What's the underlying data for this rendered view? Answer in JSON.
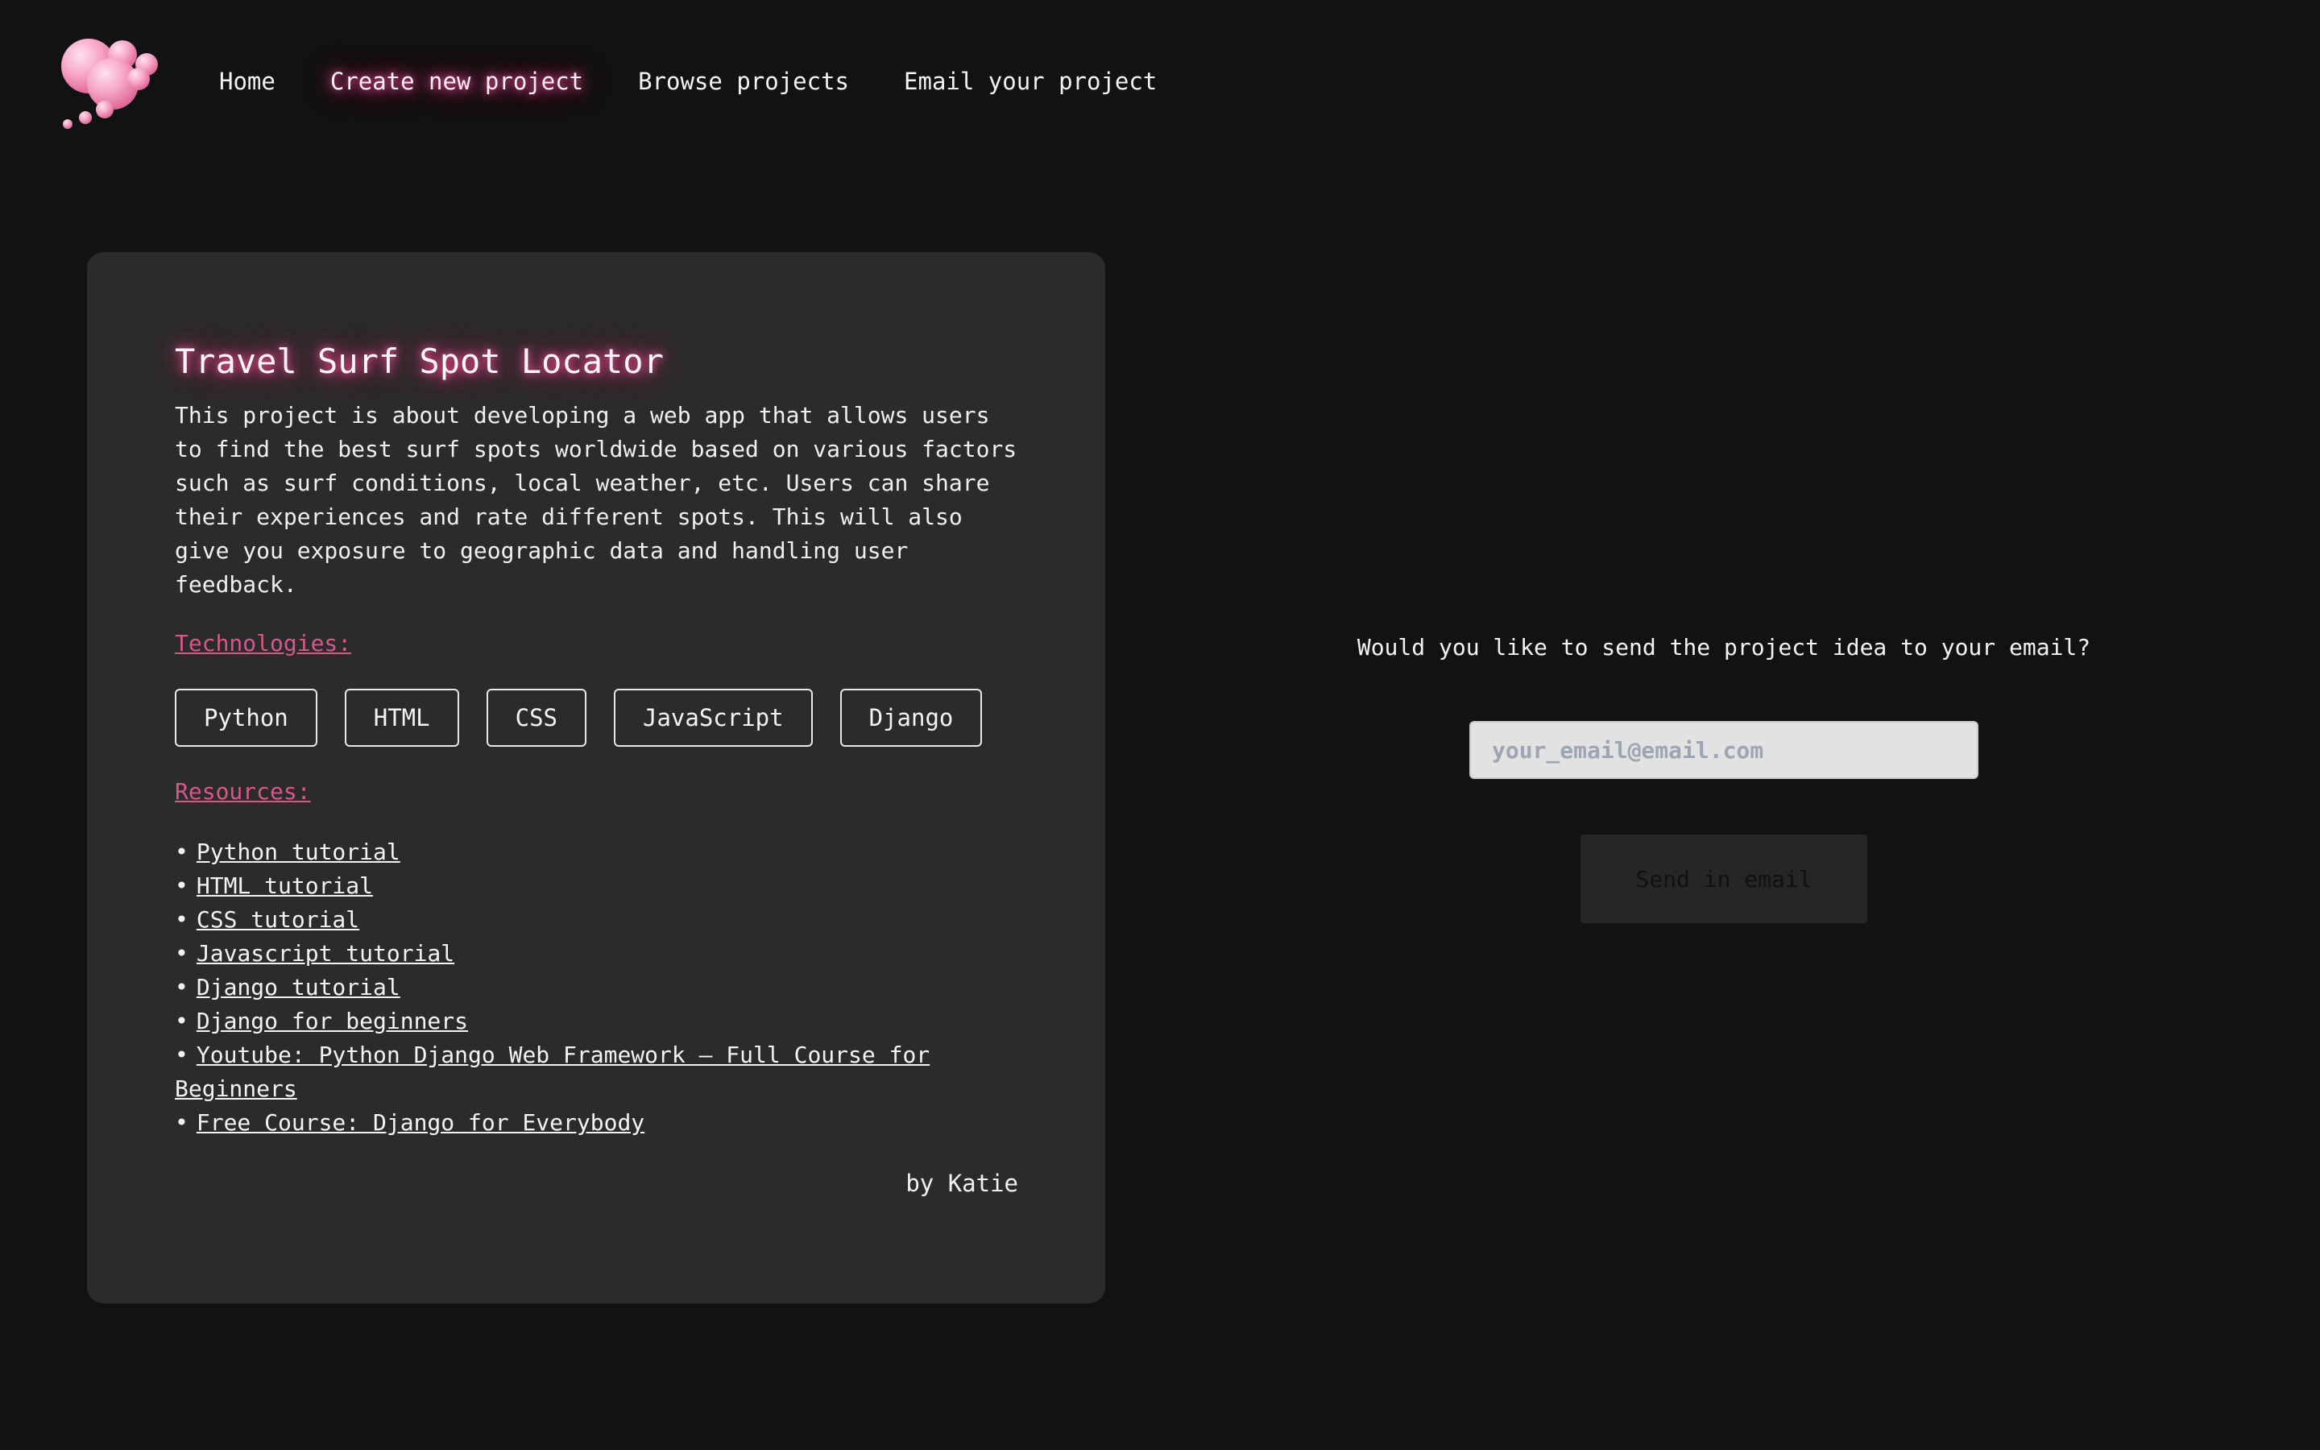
{
  "nav": {
    "items": [
      {
        "label": "Home"
      },
      {
        "label": "Create new project"
      },
      {
        "label": "Browse projects"
      },
      {
        "label": "Email your project"
      }
    ]
  },
  "project": {
    "title": "Travel Surf Spot Locator",
    "description": "This project is about developing a web app that allows users to find the best surf spots worldwide based on various factors such as surf conditions, local weather, etc. Users can share their experiences and rate different spots. This will also give you exposure to geographic data and handling user feedback.",
    "technologies_label": "Technologies:",
    "technologies": [
      "Python",
      "HTML",
      "CSS",
      "JavaScript",
      "Django"
    ],
    "resources_label": "Resources:",
    "resources": [
      "Python tutorial",
      "HTML tutorial",
      "CSS tutorial",
      "Javascript tutorial",
      "Django tutorial",
      "Django for beginners",
      "Youtube: Python Django Web Framework – Full Course for Beginners",
      "Free Course: Django for Everybody"
    ],
    "author": "by Katie"
  },
  "email_panel": {
    "prompt": "Would you like to send the project idea to your email?",
    "placeholder": "your_email@email.com",
    "send_label": "Send in email"
  },
  "colors": {
    "background": "#121212",
    "card": "#2b2b2b",
    "accent_pink": "#d8578a",
    "glow": "#ff5aa0"
  }
}
